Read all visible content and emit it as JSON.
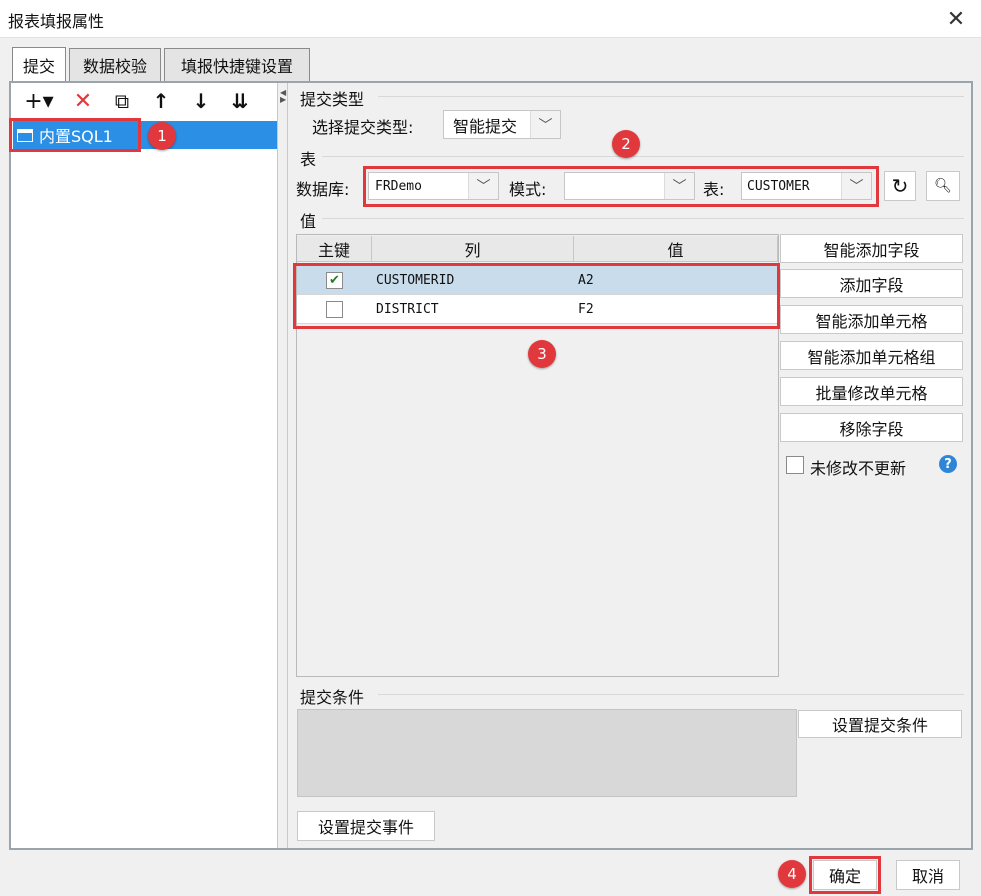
{
  "window": {
    "title": "报表填报属性"
  },
  "tabs": [
    {
      "label": "提交"
    },
    {
      "label": "数据校验"
    },
    {
      "label": "填报快捷键设置"
    }
  ],
  "toolbar": {
    "add": "+▾",
    "delete": "✕",
    "copy": "⧉",
    "up": "↑",
    "down": "↓",
    "sort": "⇊"
  },
  "tree": {
    "items": [
      {
        "label": "内置SQL1"
      }
    ]
  },
  "submit_type": {
    "section": "提交类型",
    "label": "选择提交类型:",
    "value": "智能提交"
  },
  "table_section": {
    "section": "表",
    "database_label": "数据库:",
    "database_value": "FRDemo",
    "schema_label": "模式:",
    "schema_value": "",
    "table_label": "表:",
    "table_value": "CUSTOMER"
  },
  "values_section": {
    "section": "值",
    "columns": [
      "主键",
      "列",
      "值"
    ],
    "rows": [
      {
        "primary_key": true,
        "column": "CUSTOMERID",
        "value": "A2"
      },
      {
        "primary_key": false,
        "column": "DISTRICT",
        "value": "F2"
      }
    ]
  },
  "side_buttons": {
    "smart_add_field": "智能添加字段",
    "add_field": "添加字段",
    "smart_add_cell": "智能添加单元格",
    "smart_add_cell_group": "智能添加单元格组",
    "batch_edit_cell": "批量修改单元格",
    "remove_field": "移除字段",
    "unmodified_no_update": "未修改不更新"
  },
  "condition": {
    "section": "提交条件",
    "button": "设置提交条件"
  },
  "event": {
    "button": "设置提交事件"
  },
  "footer": {
    "ok": "确定",
    "cancel": "取消"
  },
  "badges": [
    "1",
    "2",
    "3",
    "4"
  ],
  "colors": {
    "highlight": "#e0383c",
    "selection": "#2b8fe6",
    "accent_blue": "#2f86d6"
  }
}
